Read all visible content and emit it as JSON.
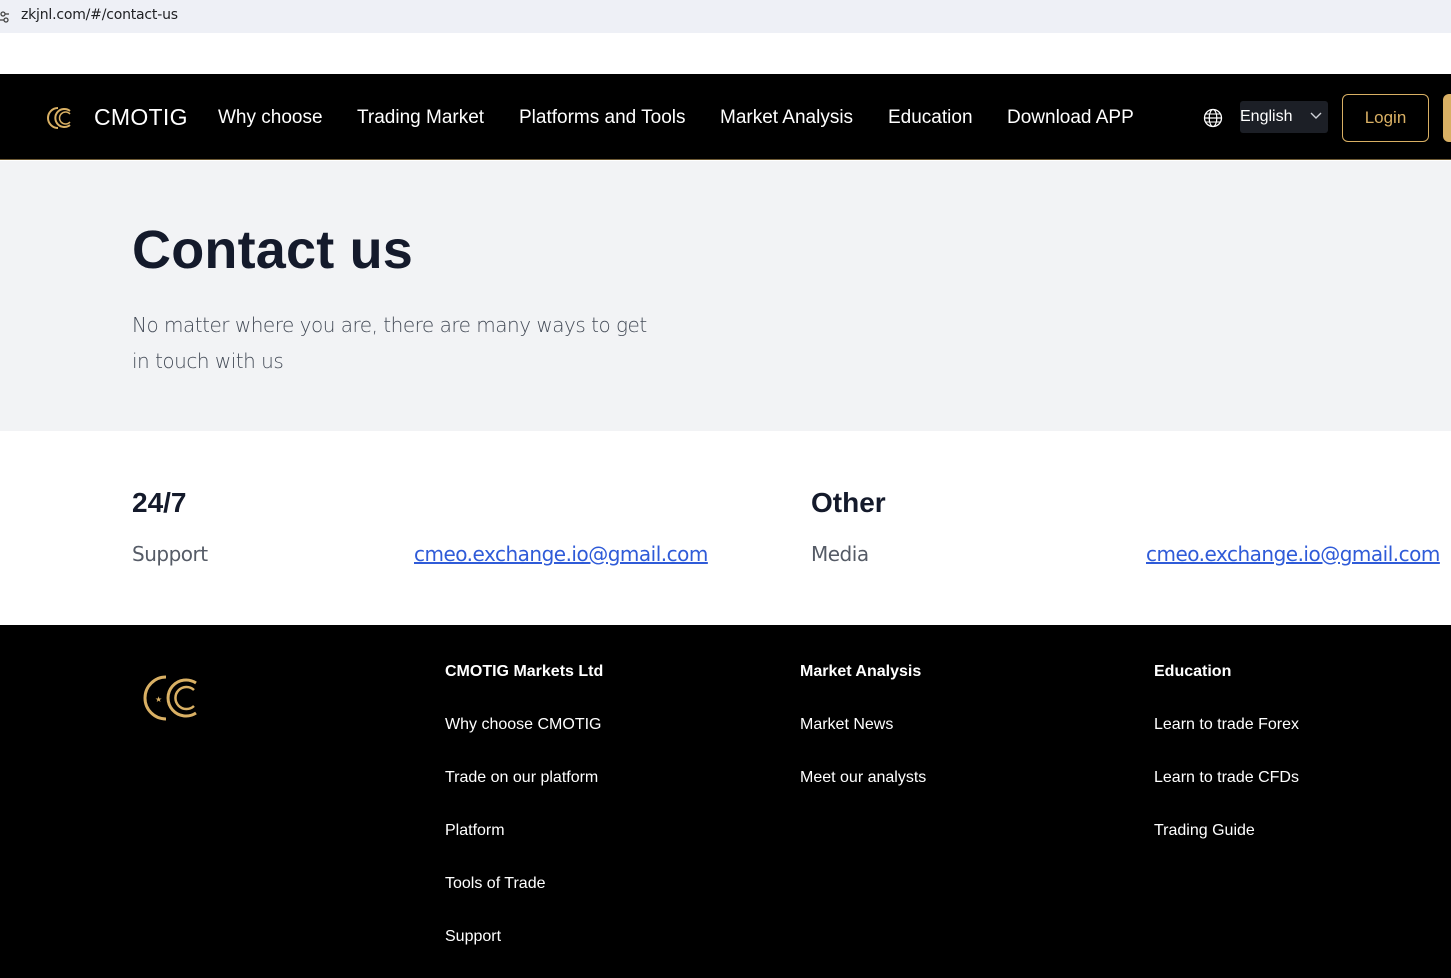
{
  "browser": {
    "url": "zkjnl.com/#/contact-us",
    "site_icon": "site-info-icon"
  },
  "navbar": {
    "logo_icon": "cmotig-logo-icon",
    "brand": "CMOTIG",
    "items": [
      {
        "label": "Why choose"
      },
      {
        "label": "Trading Market"
      },
      {
        "label": "Platforms and Tools"
      },
      {
        "label": "Market Analysis"
      },
      {
        "label": "Education"
      },
      {
        "label": "Download APP"
      }
    ],
    "language_icon": "globe-icon",
    "language": "English",
    "login_label": "Login",
    "accent_color": "#d9b064"
  },
  "hero": {
    "title": "Contact us",
    "subtitle": "No matter where you are, there are many ways to get in touch with us"
  },
  "contacts": [
    {
      "title": "24/7",
      "label": "Support",
      "email": "cmeo.exchange.io@gmail.com"
    },
    {
      "title": "Other",
      "label": "Media",
      "email": "cmeo.exchange.io@gmail.com"
    }
  ],
  "footer": {
    "logo_icon": "cmotig-logo-icon",
    "columns": [
      {
        "title": "CMOTIG Markets Ltd",
        "links": [
          "Why choose CMOTIG",
          "Trade on our platform",
          "Platform",
          "Tools of Trade",
          "Support"
        ]
      },
      {
        "title": "Market Analysis",
        "links": [
          "Market News",
          "Meet our analysts"
        ]
      },
      {
        "title": "Education",
        "links": [
          "Learn to trade Forex",
          "Learn to trade CFDs",
          "Trading Guide"
        ]
      }
    ]
  }
}
